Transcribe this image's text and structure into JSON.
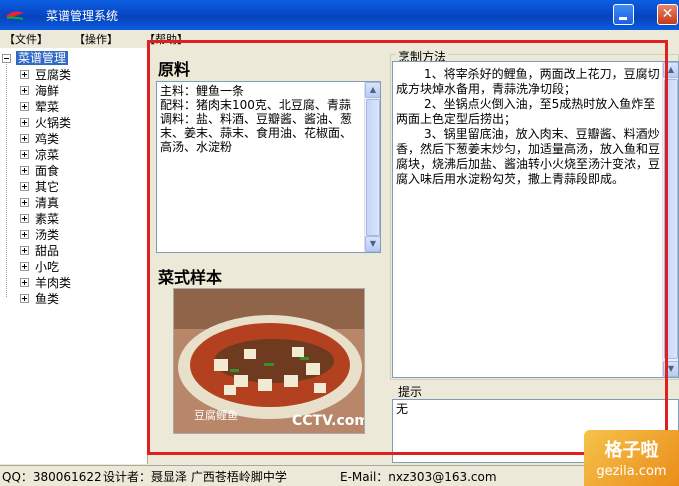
{
  "window": {
    "title": "菜谱管理系统"
  },
  "menu": {
    "file": "【文件】",
    "operate": "【操作】",
    "help": "【帮助】"
  },
  "tree": {
    "root": "菜谱管理",
    "items": [
      "豆腐类",
      "海鲜",
      "荤菜",
      "火锅类",
      "鸡类",
      "凉菜",
      "面食",
      "其它",
      "清真",
      "素菜",
      "汤类",
      "甜品",
      "小吃",
      "羊肉类",
      "鱼类"
    ]
  },
  "ingredients": {
    "title": "原料",
    "lines": [
      "主料：鲤鱼一条",
      "配料：猪肉末100克、北豆腐、青蒜",
      "调料：盐、料酒、豆瓣酱、酱油、葱末、姜末、蒜末、食用油、花椒面、高汤、水淀粉"
    ]
  },
  "sample": {
    "title": "菜式样本",
    "photo_caption": "豆腐鲤鱼",
    "photo_logo": "CCTV.com"
  },
  "method": {
    "title": "烹制方法",
    "steps": [
      "1、将宰杀好的鲤鱼，两面改上花刀，豆腐切成方块焯水备用，青蒜洗净切段；",
      "2、坐锅点火倒入油，至5成热时放入鱼炸至两面上色定型后捞出；",
      "3、锅里留底油，放入肉末、豆瓣酱、料酒炒香，然后下葱姜末炒匀，加适量高汤，放入鱼和豆腐块，烧沸后加盐、酱油转小火烧至汤汁变浓，豆腐入味后用水淀粉勾芡，撒上青蒜段即成。"
    ]
  },
  "tips": {
    "title": "提示",
    "value": "无"
  },
  "status": {
    "qq": "QQ：380061622",
    "designer": "设计者：聂显泽   广西苍梧岭脚中学",
    "email": "E-Mail：nxz303@163.com"
  },
  "watermark": {
    "line1": "格子啦",
    "line2": "gezila.com"
  },
  "colors": {
    "titlebar": "#0a5fe0",
    "selection": "#316ac5",
    "highlight": "#e02020"
  }
}
